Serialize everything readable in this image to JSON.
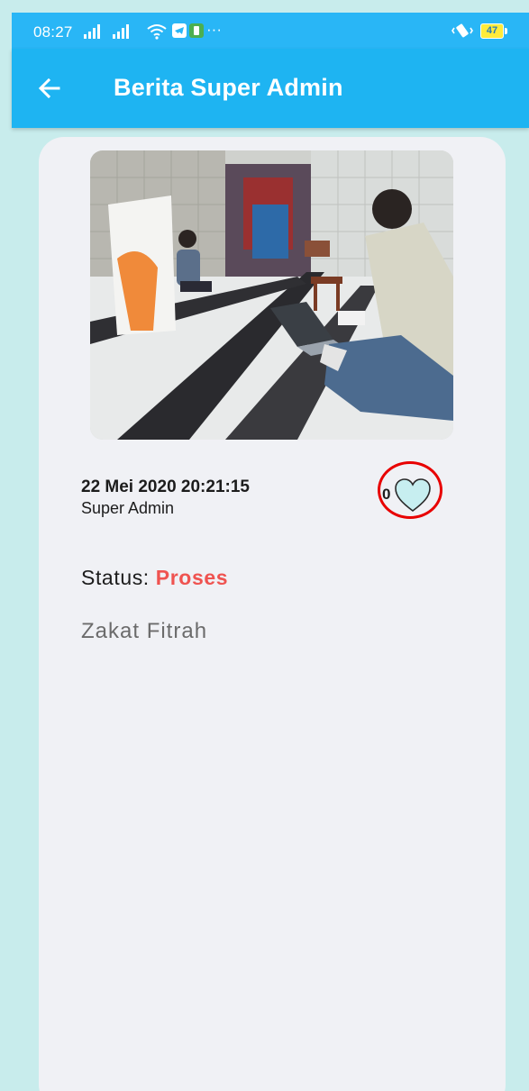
{
  "status_bar": {
    "time": "08:27",
    "battery_level": "47",
    "more_indicator": "···"
  },
  "app_bar": {
    "title": "Berita Super Admin",
    "back_icon": "arrow-left-icon",
    "color": "#1eb4f2"
  },
  "post": {
    "date": "22 Mei 2020 20:21:15",
    "author": "Super Admin",
    "likes": "0",
    "like_icon": "heart-outline-icon",
    "status_label": "Status: ",
    "status_value": "Proses",
    "status_color": "#ef5350",
    "category": "Zakat Fitrah"
  },
  "colors": {
    "background": "#c8ecec",
    "card": "#f0f1f5",
    "highlight": "#e80000"
  }
}
